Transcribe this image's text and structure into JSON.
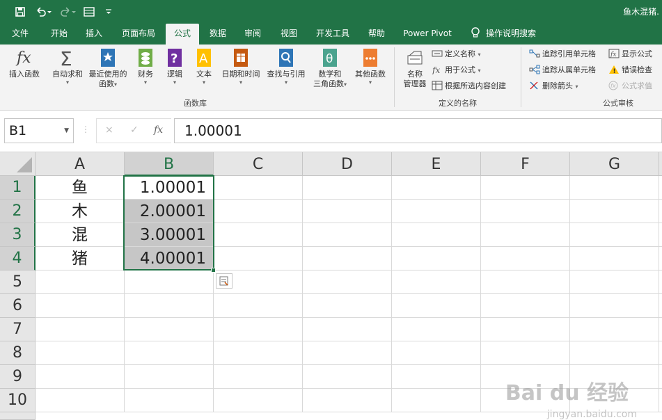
{
  "window": {
    "title": "鱼木混猪."
  },
  "tabs": [
    {
      "label": "文件"
    },
    {
      "label": "开始"
    },
    {
      "label": "插入"
    },
    {
      "label": "页面布局"
    },
    {
      "label": "公式"
    },
    {
      "label": "数据"
    },
    {
      "label": "审阅"
    },
    {
      "label": "视图"
    },
    {
      "label": "开发工具"
    },
    {
      "label": "帮助"
    },
    {
      "label": "Power Pivot"
    }
  ],
  "tell_me": "操作说明搜索",
  "ribbon": {
    "insert_function": "插入函数",
    "autosum": "自动求和",
    "recent_line1": "最近使用的",
    "recent_line2": "函数",
    "financial": "财务",
    "logical": "逻辑",
    "text": "文本",
    "datetime": "日期和时间",
    "lookup": "查找与引用",
    "math_line1": "数学和",
    "math_line2": "三角函数",
    "more": "其他函数",
    "group_library": "函数库",
    "name_manager_line1": "名称",
    "name_manager_line2": "管理器",
    "define_name": "定义名称",
    "use_in_formula": "用于公式",
    "create_from_selection": "根据所选内容创建",
    "group_names": "定义的名称",
    "trace_precedents": "追踪引用单元格",
    "trace_dependents": "追踪从属单元格",
    "remove_arrows": "删除箭头",
    "show_formulas": "显示公式",
    "error_checking": "错误检查",
    "evaluate_formula": "公式求值",
    "group_audit": "公式审核"
  },
  "formula_bar": {
    "name_box": "B1",
    "formula": "1.00001",
    "cancel_glyph": "×",
    "enter_glyph": "✓",
    "fx_glyph": "fx"
  },
  "grid": {
    "columns": [
      "A",
      "B",
      "C",
      "D",
      "E",
      "F",
      "G"
    ],
    "rows": [
      "1",
      "2",
      "3",
      "4",
      "5",
      "6",
      "7",
      "8",
      "9",
      "10"
    ],
    "cells": {
      "A1": "鱼",
      "A2": "木",
      "A3": "混",
      "A4": "猪",
      "B1": "1.00001",
      "B2": "2.00001",
      "B3": "3.00001",
      "B4": "4.00001"
    }
  },
  "watermark": {
    "main": "Bai du 经验",
    "sub": "jingyan.baidu.com"
  },
  "colors": {
    "accent": "#217346",
    "selection_fill": "#c6c6c6"
  }
}
